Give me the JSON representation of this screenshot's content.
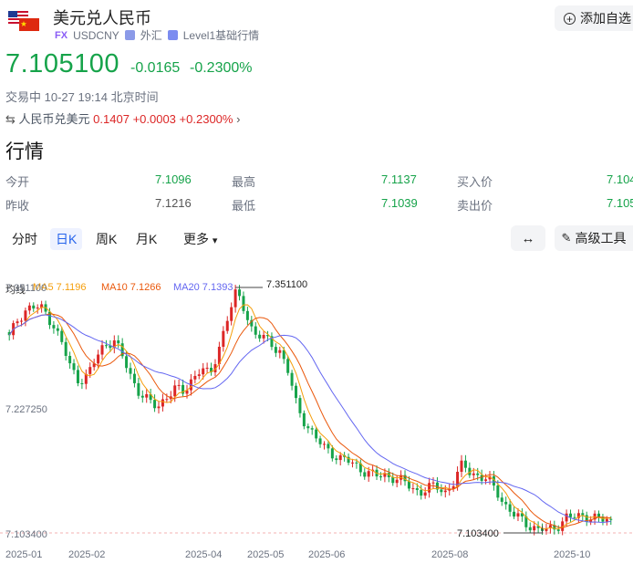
{
  "header": {
    "title": "美元兑人民币",
    "fx_badge": "FX",
    "symbol": "USDCNY",
    "category": "外汇",
    "quote_level": "Level1基础行情",
    "add_watchlist": "添加自选"
  },
  "quote": {
    "price": "7.105100",
    "change": "-0.0165",
    "change_pct": "-0.2300%",
    "status": "交易中 10-27 19:14 北京时间",
    "inverse_label": "人民币兑美元",
    "inverse_price": "0.1407",
    "inverse_change": "+0.0003",
    "inverse_change_pct": "+0.2300%"
  },
  "market": {
    "title": "行情",
    "open_label": "今开",
    "open": "7.1096",
    "high_label": "最高",
    "high": "7.1137",
    "bid_label": "买入价",
    "bid": "7.104",
    "prev_close_label": "昨收",
    "prev_close": "7.1216",
    "low_label": "最低",
    "low": "7.1039",
    "ask_label": "卖出价",
    "ask": "7.105"
  },
  "tabs": {
    "intraday": "分时",
    "daily": "日K",
    "weekly": "周K",
    "monthly": "月K",
    "more": "更多",
    "advanced": "高级工具"
  },
  "legend": {
    "label": "均线",
    "ma5": "MA5 7.1196",
    "ma10": "MA10 7.1266",
    "ma20": "MA20 7.1393"
  },
  "colors": {
    "up": "#dc2626",
    "down": "#16a34a",
    "ma5": "#f59e0b",
    "ma10": "#ea580c",
    "ma20": "#6366f1"
  },
  "chart_data": {
    "type": "candlestick",
    "ylim": [
      7.1034,
      7.3511
    ],
    "y_ticks": [
      "7.351100",
      "7.227250",
      "7.103400"
    ],
    "x_ticks": [
      "2025-01",
      "2025-02",
      "2025-04",
      "2025-05",
      "2025-06",
      "2025-08",
      "2025-10"
    ],
    "max_label": "7.351100",
    "min_label": "7.103400",
    "close_series": [
      7.3,
      7.32,
      7.33,
      7.331,
      7.328,
      7.315,
      7.295,
      7.27,
      7.258,
      7.262,
      7.28,
      7.295,
      7.298,
      7.28,
      7.26,
      7.245,
      7.235,
      7.23,
      7.242,
      7.248,
      7.245,
      7.26,
      7.27,
      7.26,
      7.29,
      7.32,
      7.345,
      7.33,
      7.305,
      7.3,
      7.295,
      7.288,
      7.265,
      7.23,
      7.215,
      7.2,
      7.19,
      7.185,
      7.178,
      7.175,
      7.17,
      7.165,
      7.16,
      7.162,
      7.16,
      7.155,
      7.15,
      7.145,
      7.148,
      7.15,
      7.145,
      7.155,
      7.172,
      7.165,
      7.16,
      7.155,
      7.145,
      7.13,
      7.12,
      7.115,
      7.11,
      7.105,
      7.106,
      7.112,
      7.12,
      7.118,
      7.122,
      7.119,
      7.116,
      7.115
    ]
  }
}
